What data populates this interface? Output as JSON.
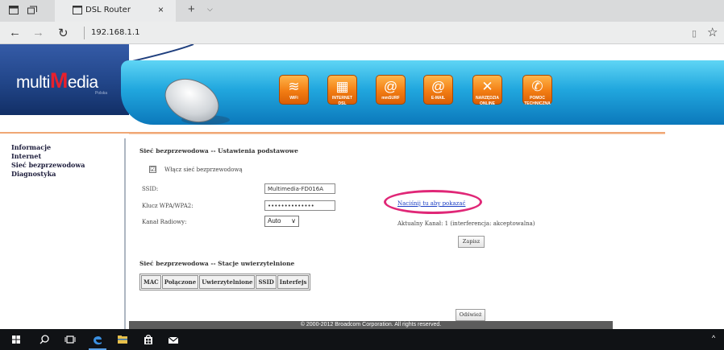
{
  "browser": {
    "tab_title": "DSL Router",
    "tab_close": "×",
    "new_tab": "+",
    "tab_menu": "⌵",
    "back": "←",
    "forward": "→",
    "refresh": "↻",
    "address": "192.168.1.1",
    "reading_view": "▯",
    "favorite": "☆"
  },
  "header": {
    "logo_prefix": "multi",
    "logo_m": "M",
    "logo_suffix": "edia",
    "logo_sub": "Polska",
    "buttons": [
      {
        "icon": "wifi-icon",
        "glyph": "≋",
        "label": "WiFi"
      },
      {
        "icon": "router-icon",
        "glyph": "▦",
        "label": "INTERNET DSL"
      },
      {
        "icon": "at-icon",
        "glyph": "@",
        "label": "mmSURF"
      },
      {
        "icon": "email-icon",
        "glyph": "@",
        "label": "E-MAIL"
      },
      {
        "icon": "tools-icon",
        "glyph": "✕",
        "label": "NARZĘDZIA ONLINE"
      },
      {
        "icon": "phone-icon",
        "glyph": "✆",
        "label": "POMOC TECHNICZNA"
      }
    ]
  },
  "sidebar": {
    "items": [
      {
        "label": "Informacje"
      },
      {
        "label": "Internet"
      },
      {
        "label": "Sieć bezprzewodowa"
      },
      {
        "label": "Diagnostyka"
      }
    ]
  },
  "wireless": {
    "title": "Sieć bezprzewodowa -- Ustawienia podstawowe",
    "enable_label": "Włącz sieć bezprzewodową",
    "enable_checked": "☑",
    "ssid_label": "SSID:",
    "ssid_value": "Multimedia-FD016A",
    "key_label": "Klucz WPA/WPA2:",
    "key_value": "••••••••••••••",
    "show_link": "Naciśnij tu aby pokazać",
    "channel_label": "Kanał Radiowy:",
    "channel_value": "Auto",
    "channel_caret": "∨",
    "current_channel": "Aktualny Kanał: 1 (interferencja: akceptowalna)",
    "save_button": "Zapisz"
  },
  "stations": {
    "title": "Sieć bezprzewodowa -- Stacje uwierzytelnione",
    "columns": [
      "MAC",
      "Połączone",
      "Uwierzytelnione",
      "SSID",
      "Interfejs"
    ],
    "refresh_button": "Odśwież"
  },
  "footer": {
    "copyright": "© 2000-2012 Broadcom Corporation. All rights reserved."
  },
  "taskbar": {
    "items": [
      "windows-start-icon",
      "search-icon",
      "task-view-icon",
      "edge-icon",
      "file-explorer-icon",
      "store-icon",
      "mail-icon"
    ],
    "tray_caret": "^"
  },
  "colors": {
    "header_blue": "#214588",
    "banner_blue": "#21a7de",
    "button_orange": "#f27d13",
    "highlight_circle": "#e02777",
    "link_blue": "#1c3fc4"
  }
}
